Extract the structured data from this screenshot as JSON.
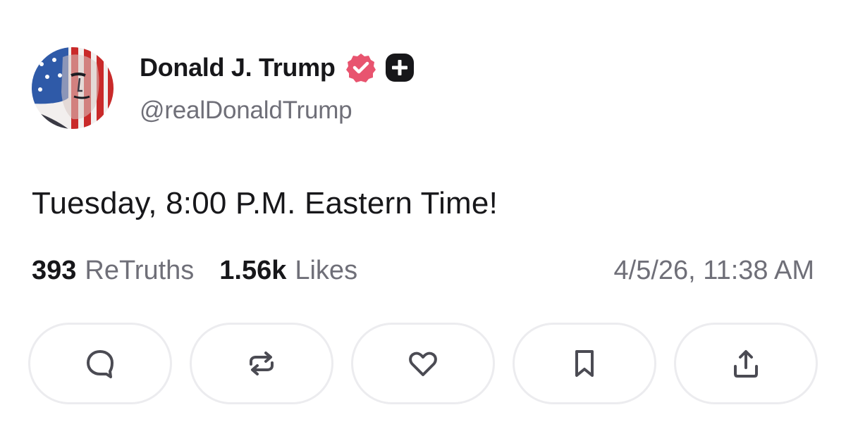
{
  "post": {
    "author": {
      "display_name": "Donald J. Trump",
      "handle": "@realDonaldTrump",
      "verified": true,
      "badges": [
        "verified-badge",
        "plus-badge"
      ]
    },
    "text": "Tuesday, 8:00 P.M. Eastern Time!",
    "stats": {
      "retruths_count": "393",
      "retruths_label": "ReTruths",
      "likes_count": "1.56k",
      "likes_label": "Likes"
    },
    "timestamp": "4/5/26, 11:38 AM"
  },
  "actions": [
    {
      "name": "reply",
      "icon": "comment-icon"
    },
    {
      "name": "retruth",
      "icon": "repost-icon"
    },
    {
      "name": "like",
      "icon": "heart-icon"
    },
    {
      "name": "bookmark",
      "icon": "bookmark-icon"
    },
    {
      "name": "share",
      "icon": "share-icon"
    }
  ],
  "colors": {
    "text_primary": "#17171a",
    "text_secondary": "#6f6f78",
    "verified_badge": "#e8546f",
    "button_border": "#ececef",
    "icon_stroke": "#4b4b53"
  }
}
